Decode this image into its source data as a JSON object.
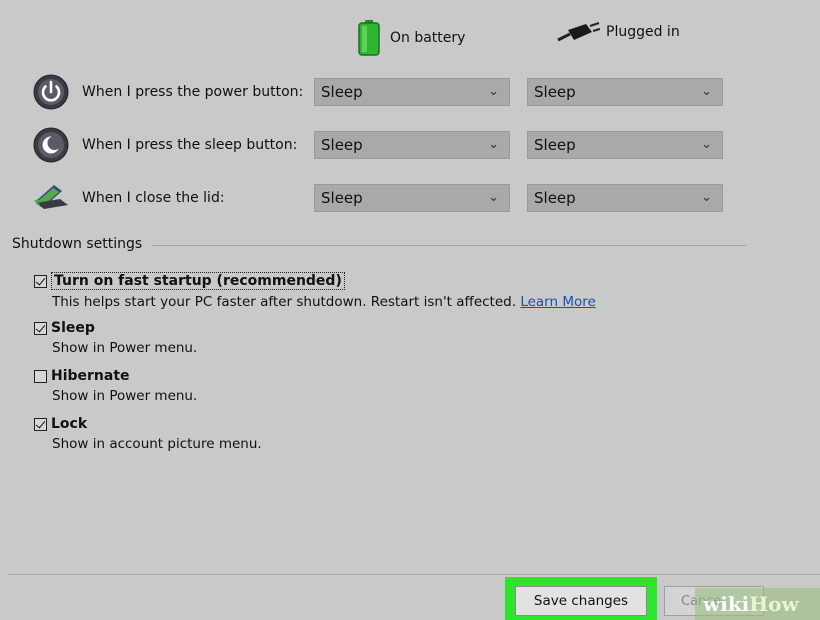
{
  "headers": {
    "battery_label": "On battery",
    "plugged_label": "Plugged in"
  },
  "rows": [
    {
      "label": "When I press the power button:",
      "battery": "Sleep",
      "plugged": "Sleep",
      "icon": "power-button-icon"
    },
    {
      "label": "When I press the sleep button:",
      "battery": "Sleep",
      "plugged": "Sleep",
      "icon": "sleep-button-icon"
    },
    {
      "label": "When I close the lid:",
      "battery": "Sleep",
      "plugged": "Sleep",
      "icon": "laptop-lid-icon"
    }
  ],
  "shutdown": {
    "title": "Shutdown settings",
    "options": [
      {
        "label": "Turn on fast startup (recommended)",
        "checked": true,
        "desc": "This helps start your PC faster after shutdown. Restart isn't affected.",
        "link": "Learn More"
      },
      {
        "label": "Sleep",
        "checked": true,
        "desc": "Show in Power menu."
      },
      {
        "label": "Hibernate",
        "checked": false,
        "desc": "Show in Power menu."
      },
      {
        "label": "Lock",
        "checked": true,
        "desc": "Show in account picture menu."
      }
    ]
  },
  "buttons": {
    "save": "Save changes",
    "cancel": "Cancel"
  },
  "watermark": {
    "part1": "wiki",
    "part2": "How"
  },
  "colors": {
    "highlight": "#2ee52e",
    "link": "#1a4fb8"
  }
}
